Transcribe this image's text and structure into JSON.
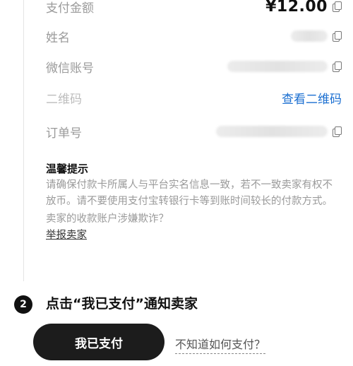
{
  "order": {
    "amount_label": "支付金额",
    "amount_value": "¥12.00",
    "name_label": "姓名",
    "wechat_label": "微信账号",
    "qrcode_label": "二维码",
    "qrcode_link": "查看二维码",
    "order_no_label": "订单号"
  },
  "tips": {
    "title": "温馨提示",
    "body": "请确保付款卡所属人与平台实名信息一致，若不一致卖家有权不放币。请不要使用支付宝转银行卡等到账时间较长的付款方式。",
    "fraud_question": "卖家的收款账户涉嫌欺诈？",
    "report_link": "举报卖家"
  },
  "step2": {
    "badge": "2",
    "title": "点击“我已支付”通知卖家",
    "paid_button": "我已支付",
    "howto_link": "不知道如何支付？"
  },
  "colors": {
    "accent_blue": "#1b6fd1",
    "button_dark": "#1c1c1c"
  }
}
